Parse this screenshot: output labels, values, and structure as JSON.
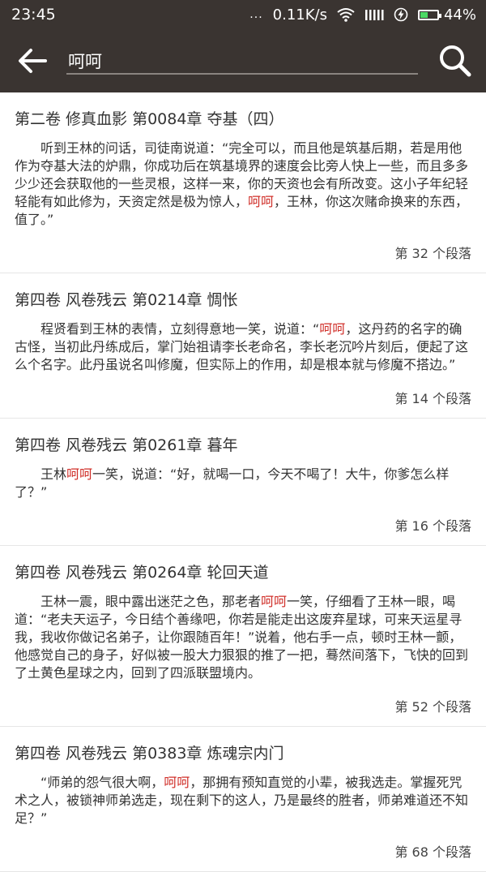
{
  "status": {
    "time": "23:45",
    "dots": "...",
    "speed": "0.11K/s",
    "battery": "44%",
    "battery_level": 0.44,
    "battery_color": "#4cd964"
  },
  "search": {
    "back_icon": "arrow-left-icon",
    "query": "呵呵",
    "search_icon": "search-icon"
  },
  "results": [
    {
      "title": "第二卷 修真血影 第0084章 夺基（四）",
      "before": "听到王林的问话，司徒南说道：“完全可以，而且他是筑基后期，若是用他作为夺基大法的炉鼎，你成功后在筑基境界的速度会比旁人快上一些，而且多多少少还会获取他的一些灵根，这样一来，你的天资也会有所改变。这小子年纪轻轻能有如此修为，天资定然是极为惊人，",
      "highlight": "呵呵",
      "after": "，王林，你这次赌命换来的东西，值了。”",
      "count": "第 32 个段落"
    },
    {
      "title": "第四卷 风卷残云 第0214章 惆怅",
      "before": "程贤看到王林的表情，立刻得意地一笑，说道：“",
      "highlight": "呵呵",
      "after": "，这丹药的名字的确古怪，当初此丹练成后，掌门始祖请李长老命名，李长老沉吟片刻后，便起了这么个名字。此丹虽说名叫修魔，但实际上的作用，却是根本就与修魔不搭边。”",
      "count": "第 14 个段落"
    },
    {
      "title": "第四卷 风卷残云 第0261章 暮年",
      "before": "王林",
      "highlight": "呵呵",
      "after": "一笑，说道：“好，就喝一口，今天不喝了！大牛，你爹怎么样了？”",
      "count": "第 16 个段落"
    },
    {
      "title": "第四卷 风卷残云 第0264章 轮回天道",
      "before": "王林一震，眼中露出迷茫之色，那老者",
      "highlight": "呵呵",
      "after": "一笑，仔细看了王林一眼，喝道：“老夫天运子，今日结个善缘吧，你若是能走出这废弃星球，可来天运星寻我，我收你做记名弟子，让你跟随百年！”说着，他右手一点，顿时王林一颤，他感觉自己的身子，好似被一股大力狠狠的推了一把，蓦然间落下，飞快的回到了土黄色星球之内，回到了四派联盟境内。",
      "count": "第 52 个段落"
    },
    {
      "title": "第四卷 风卷残云 第0383章 炼魂宗内门",
      "before": "“师弟的怨气很大啊，",
      "highlight": "呵呵",
      "after": "，那拥有预知直觉的小辈，被我选走。掌握死咒术之人，被锁神师弟选走，现在剩下的这人，乃是最终的胜者，师弟难道还不知足？”",
      "count": "第 68 个段落"
    }
  ]
}
